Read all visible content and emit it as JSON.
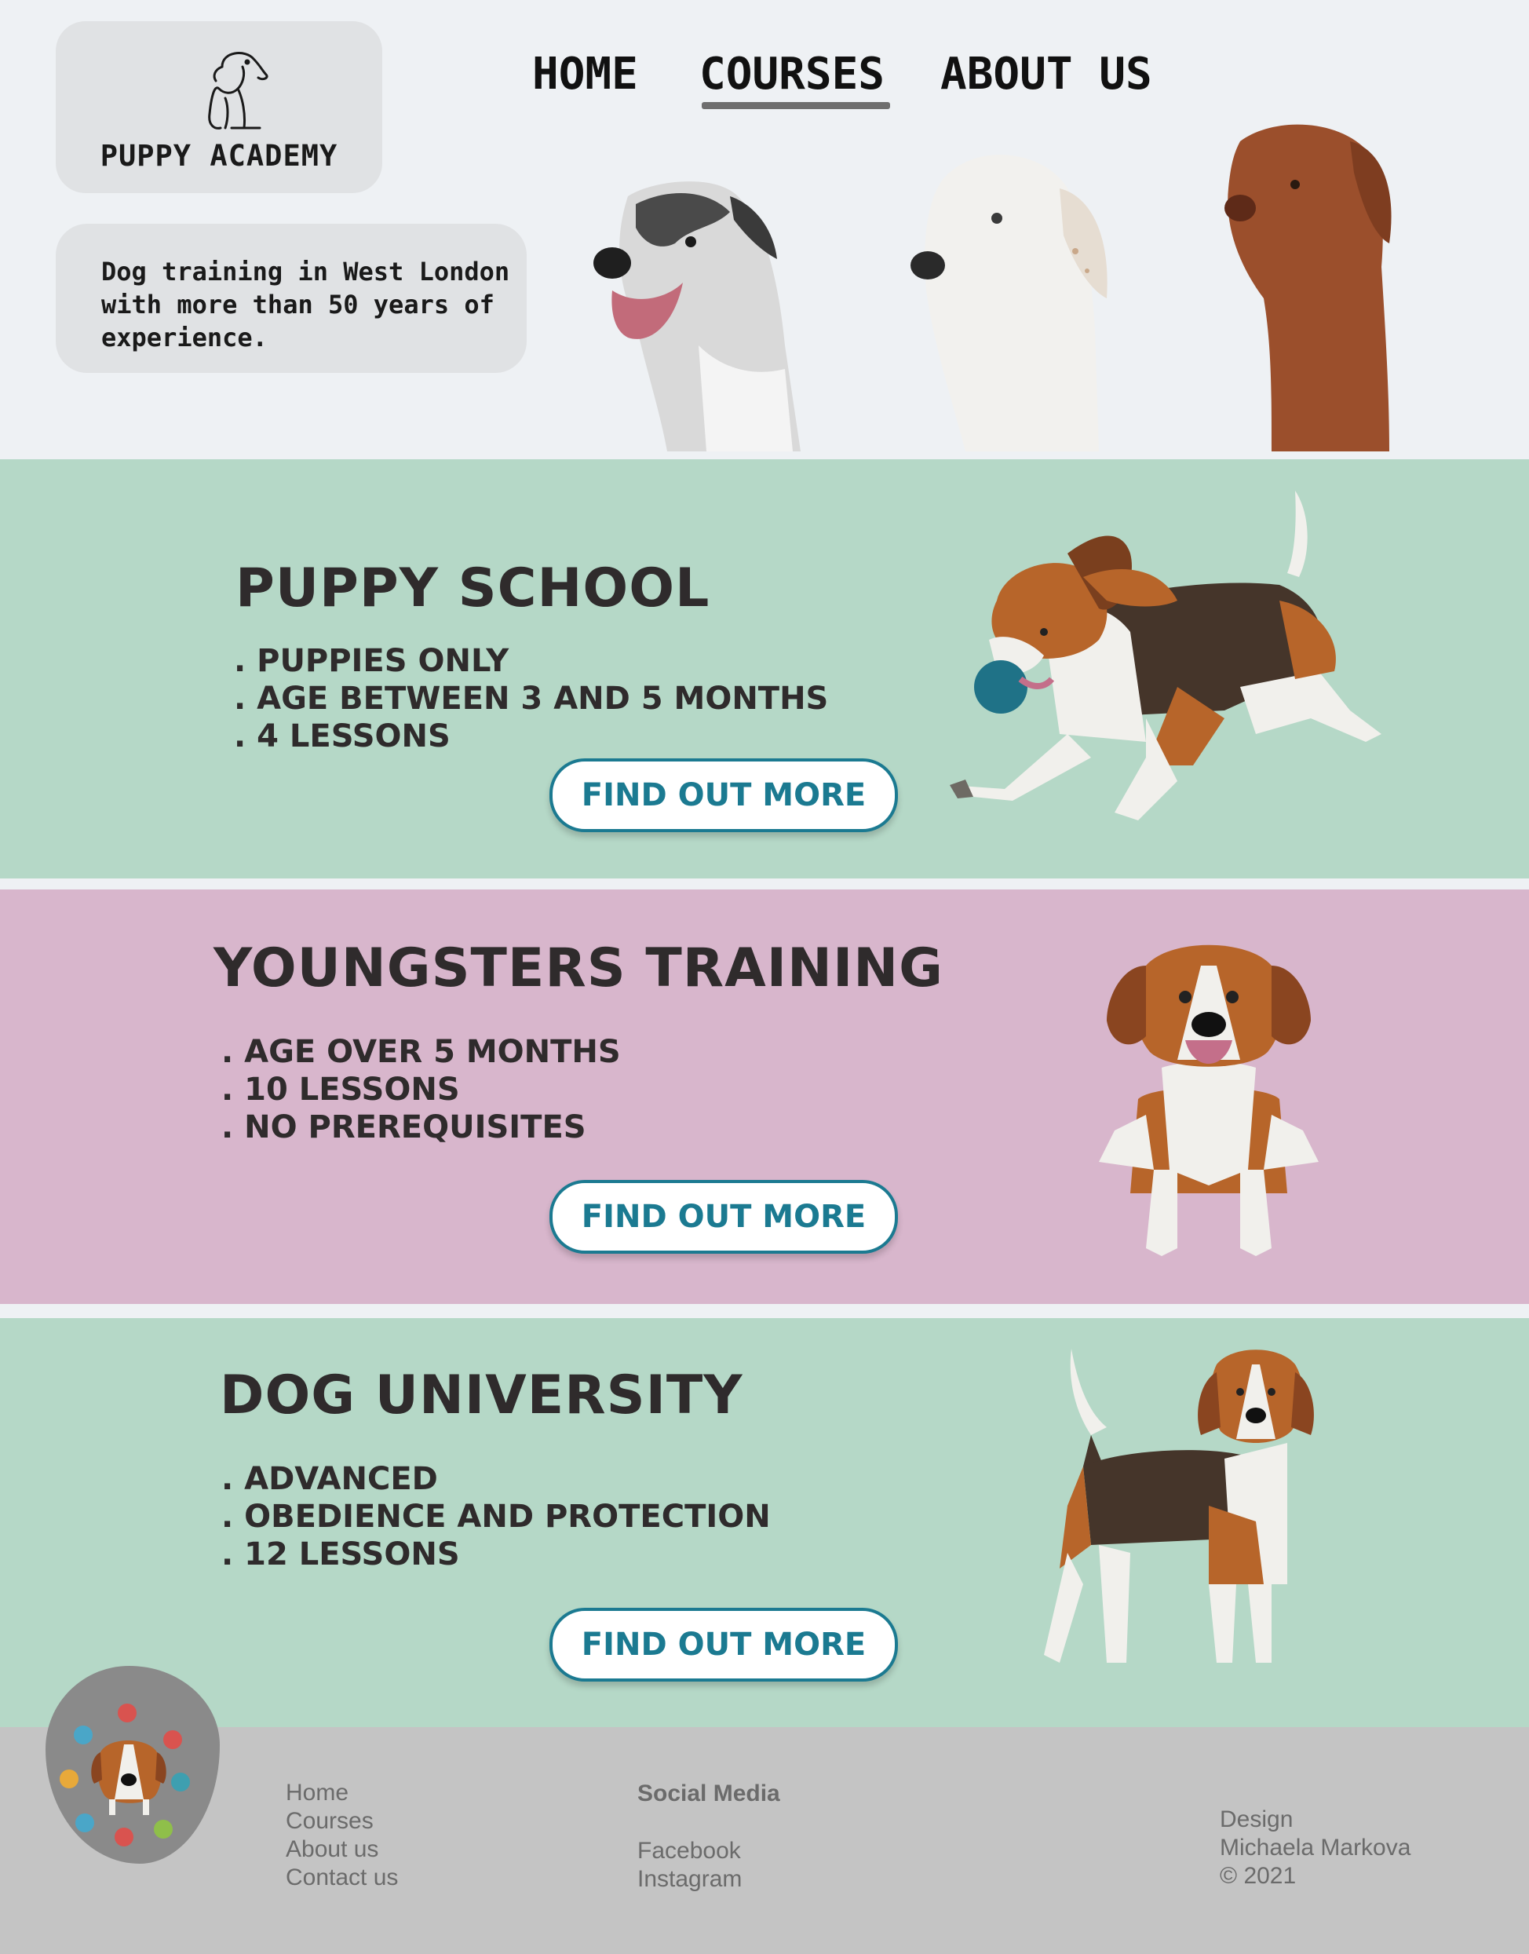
{
  "header": {
    "logo_text": "PUPPY ACADEMY",
    "tagline": "Dog training in West London with more than 50 years of experience.",
    "nav": [
      {
        "label": "HOME",
        "active": false
      },
      {
        "label": "COURSES",
        "active": true
      },
      {
        "label": "ABOUT US",
        "active": false
      }
    ]
  },
  "sections": [
    {
      "title": "PUPPY SCHOOL",
      "items": [
        ". PUPPIES ONLY",
        ". AGE BETWEEN 3 AND 5 MONTHS",
        ". 4 LESSONS"
      ],
      "button": "FIND OUT MORE",
      "bg_color": "#b5d8c7"
    },
    {
      "title": "YOUNGSTERS TRAINING",
      "items": [
        ". AGE OVER 5 MONTHS",
        ". 10 LESSONS",
        ". NO PREREQUISITES"
      ],
      "button": "FIND OUT MORE",
      "bg_color": "#d8b6cc"
    },
    {
      "title": "DOG UNIVERSITY",
      "items": [
        ". ADVANCED",
        ". OBEDIENCE AND PROTECTION",
        ". 12 LESSONS"
      ],
      "button": "FIND OUT MORE",
      "bg_color": "#b5d8c7"
    }
  ],
  "footer": {
    "nav_links": [
      "Home",
      "Courses",
      "About us",
      "Contact us"
    ],
    "social_heading": "Social Media",
    "social_links": [
      "Facebook",
      "Instagram"
    ],
    "credits": [
      "Design",
      "Michaela Markova",
      "© 2021"
    ]
  },
  "colors": {
    "accent": "#1b7a91",
    "mint": "#b5d8c7",
    "pink": "#d8b6cc",
    "footer_bg": "#c4c4c4"
  }
}
